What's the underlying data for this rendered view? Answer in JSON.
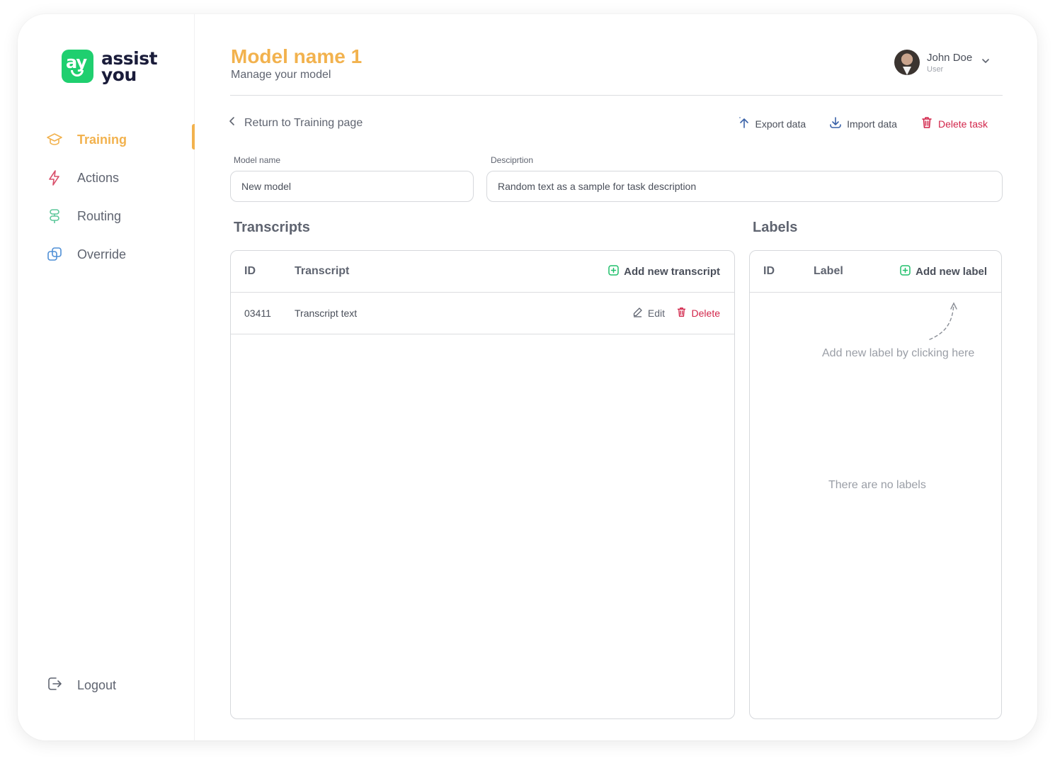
{
  "brand": {
    "mark": "ay",
    "name_line1": "assist",
    "name_line2": "you"
  },
  "sidebar": {
    "items": [
      {
        "label": "Training",
        "icon": "graduation-cap-icon",
        "active": true
      },
      {
        "label": "Actions",
        "icon": "lightning-icon",
        "active": false
      },
      {
        "label": "Routing",
        "icon": "signpost-icon",
        "active": false
      },
      {
        "label": "Override",
        "icon": "layers-icon",
        "active": false
      }
    ],
    "logout_label": "Logout"
  },
  "header": {
    "title": "Model name 1",
    "subtitle": "Manage your model",
    "user": {
      "name": "John Doe",
      "role": "User"
    }
  },
  "toolbar": {
    "back_label": "Return to Training page",
    "export_label": "Export data",
    "import_label": "Import data",
    "delete_label": "Delete task"
  },
  "form": {
    "model_name_label": "Model name",
    "model_name_value": "New model",
    "description_label": "Desciprtion",
    "description_value": "Random text as a sample for task description"
  },
  "transcripts": {
    "title": "Transcripts",
    "col_id": "ID",
    "col_transcript": "Transcript",
    "add_label": "Add new transcript",
    "rows": [
      {
        "id": "03411",
        "text": "Transcript text",
        "edit_label": "Edit",
        "delete_label": "Delete"
      }
    ]
  },
  "labels": {
    "title": "Labels",
    "col_id": "ID",
    "col_label": "Label",
    "add_label": "Add new label",
    "hint": "Add new label by clicking here",
    "empty": "There are no labels"
  },
  "colors": {
    "accent": "#f2b24e",
    "brand_green": "#1fcf6f",
    "danger": "#d2254a",
    "add_icon": "#1fbf6a"
  }
}
